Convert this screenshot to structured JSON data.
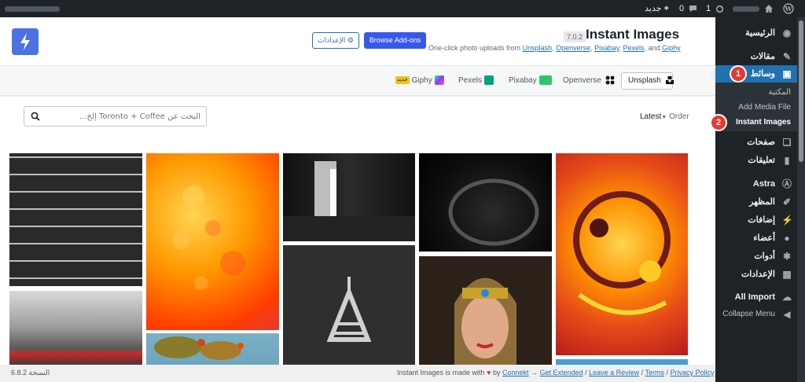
{
  "admin_bar": {
    "new_label": "جديد",
    "comments_count": "0",
    "updates_count": "1"
  },
  "sidebar": {
    "items": [
      {
        "label": "الرئيسية",
        "icon": "dashboard-icon"
      },
      {
        "label": "مقالات",
        "icon": "pin-icon"
      },
      {
        "label": "وسائط",
        "icon": "media-icon"
      },
      {
        "label": "صفحات",
        "icon": "pages-icon"
      },
      {
        "label": "تعليقات",
        "icon": "comment-icon"
      },
      {
        "label": "Astra",
        "icon": "astra-icon"
      },
      {
        "label": "المظهر",
        "icon": "brush-icon"
      },
      {
        "label": "إضافات",
        "icon": "plugin-icon"
      },
      {
        "label": "أعضاء",
        "icon": "user-icon"
      },
      {
        "label": "أدوات",
        "icon": "wrench-icon"
      },
      {
        "label": "الإعدادات",
        "icon": "settings-icon"
      },
      {
        "label": "All Import",
        "icon": "cloud-icon"
      },
      {
        "label": "Collapse Menu",
        "icon": "collapse-icon"
      }
    ],
    "submenu": [
      "المكتبة",
      "Add Media File",
      "Instant Images"
    ],
    "badges": [
      "1",
      "2"
    ],
    "accent": "#2271b1"
  },
  "header": {
    "title": "Instant Images",
    "version": "7.0.2",
    "subtitle_prefix": "One-click photo uploads from",
    "sources": [
      "Unsplash",
      "Openverse",
      "Pixabay",
      "Pexels"
    ],
    "and_word": "and",
    "last_source": "Giphy",
    "settings_button": "الإعدادات",
    "addons_button": "Browse Add-ons"
  },
  "providers": [
    {
      "name": "Unsplash",
      "selected": true
    },
    {
      "name": "Openverse",
      "selected": false
    },
    {
      "name": "Pixabay",
      "selected": false
    },
    {
      "name": "Pexels",
      "selected": false
    },
    {
      "name": "Giphy",
      "selected": false,
      "tag": "جديد"
    }
  ],
  "search": {
    "placeholder": "البحث عن Toronto + Coffee إلخ..."
  },
  "order": {
    "label": "Order",
    "value": "Latest"
  },
  "footer": {
    "version": "النسخة 6.8.2",
    "made_with": "Instant Images is made with",
    "by": "by",
    "author": "Connekt",
    "arrow": "→",
    "get_extended": "Get Extended",
    "review": "Leave a Review",
    "terms": "Terms",
    "privacy": "Privacy Policy"
  }
}
